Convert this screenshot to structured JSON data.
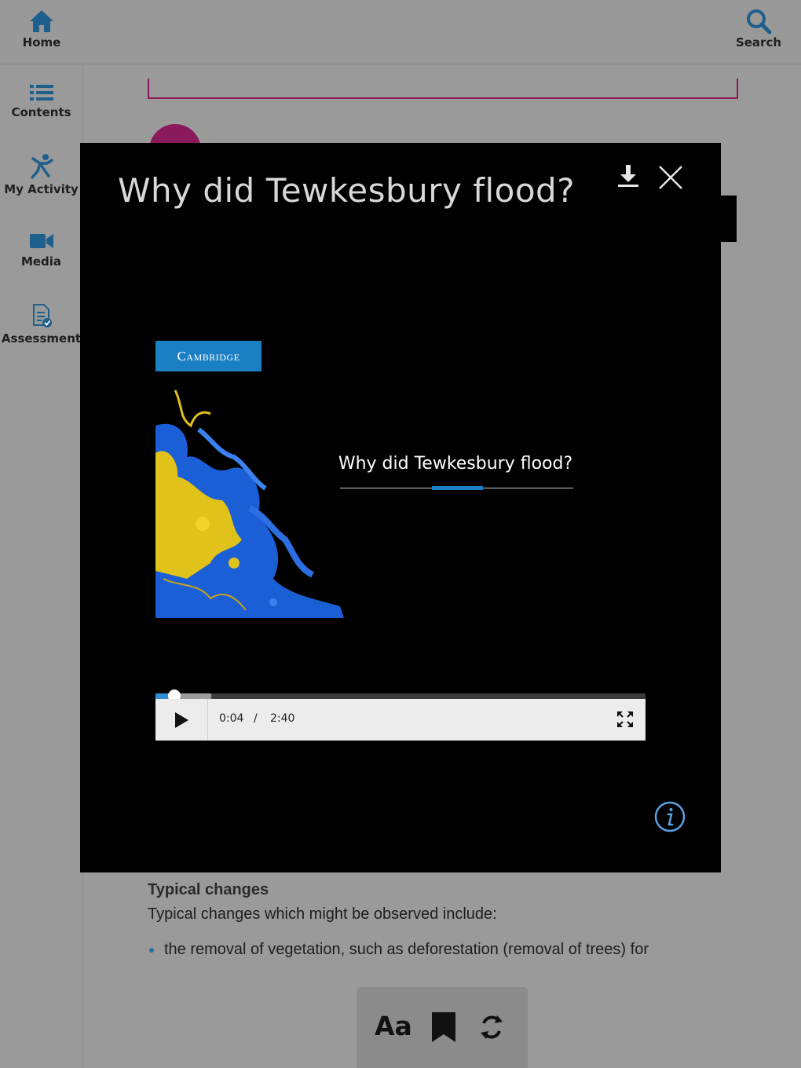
{
  "topbar": {
    "home_label": "Home",
    "search_label": "Search"
  },
  "sidebar": {
    "items": [
      {
        "label": "Contents",
        "icon": "list-icon"
      },
      {
        "label": "My Activity",
        "icon": "activity-person-icon"
      },
      {
        "label": "Media",
        "icon": "video-camera-icon"
      },
      {
        "label": "Assessment",
        "icon": "assessment-document-icon"
      }
    ]
  },
  "background_content": {
    "heading": "Typical changes",
    "paragraph": "Typical changes which might be observed include:",
    "bullet": "the removal of vegetation, such as deforestation (removal of trees) for"
  },
  "toolbar": {
    "font_label": "Aa",
    "icons": [
      "font-size-icon",
      "bookmark-icon",
      "sync-icon"
    ]
  },
  "modal": {
    "title": "Why did Tewkesbury flood?",
    "icons": [
      "download-icon",
      "close-icon",
      "info-icon"
    ]
  },
  "video": {
    "brand": "Cambridge",
    "title": "Why did Tewkesbury flood?",
    "current_time": "0:04",
    "separator": "/",
    "duration": "2:40",
    "progress_fraction": 0.025,
    "buffered_fraction": 0.113
  },
  "colors": {
    "accent_blue": "#1b7fc4",
    "brand_magenta": "#8a1a5c",
    "icon_blue": "#1f5f8b",
    "overlay_grey": "#9a9a9a"
  }
}
